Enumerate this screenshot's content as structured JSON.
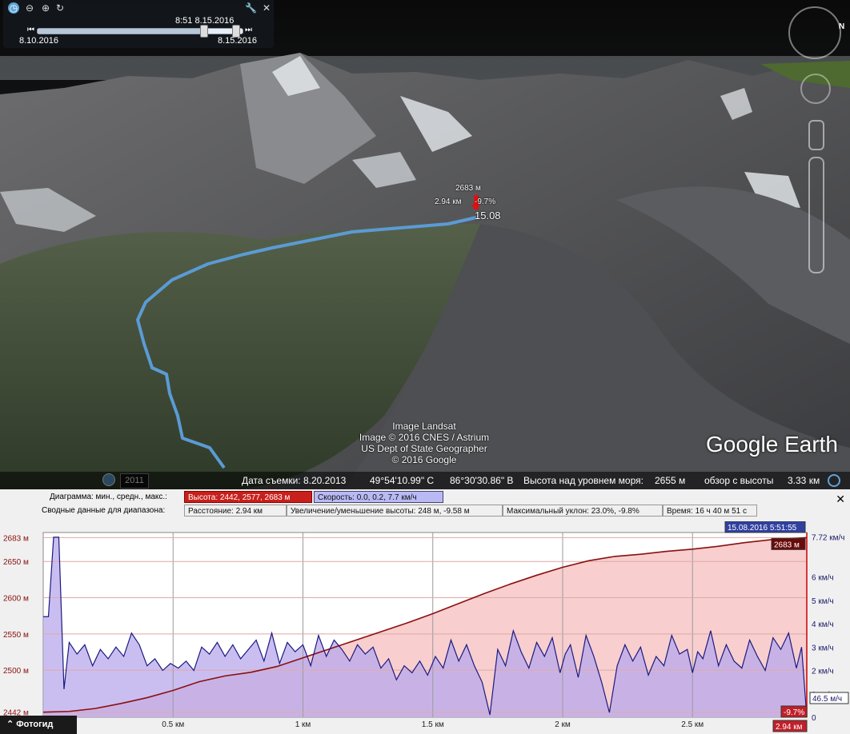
{
  "time_slider": {
    "current": "8:51 8.15.2016",
    "start": "8.10.2016",
    "end": "8.15.2016"
  },
  "map": {
    "marker_elev": "2683 м",
    "marker_dist": "2.94 км",
    "marker_grade": "-9.7%",
    "marker_time": "15.08",
    "attribution": [
      "Image Landsat",
      "Image © 2016 CNES / Astrium",
      "US Dept of State Geographer",
      "© 2016 Google"
    ],
    "brand": "Google Earth",
    "historical_year": "2011",
    "compass_letter": "N"
  },
  "status": {
    "date_label": "Дата съемки: 8.20.2013",
    "lat": "49°54'10.99\" С",
    "lon": "86°30'30.86\" В",
    "elev_label": "Высота над уровнем моря:",
    "elev_value": "2655 м",
    "eye_label": "обзор с высоты",
    "eye_value": "3.33 км"
  },
  "profile": {
    "row1_caption": "Диаграмма: мин., средн., макс.:",
    "height_box": "Высота: 2442, 2577, 2683 м",
    "speed_box": "Скорость: 0.0, 0.2, 7.7 км/ч",
    "row2_caption": "Сводные данные для диапазона:",
    "distance_box": "Расстояние: 2.94 км",
    "gain_box": "Увеличение/уменьшение высоты: 248 м, -9.58 м",
    "slope_box": "Максимальный уклон: 23.0%, -9.8%",
    "time_box": "Время: 16 ч 40 м 51 с",
    "cursor_time": "15.08.2016 5:51:55",
    "cursor_elev": "2683 м",
    "cursor_speed": "46.5 м/ч",
    "cursor_grade": "-9.7%",
    "cursor_dist": "2.94 км",
    "close": "✕"
  },
  "chart_data": {
    "type": "area",
    "x_ticks": [
      "0.5 км",
      "1 км",
      "1.5 км",
      "2 км",
      "2.5 км"
    ],
    "x_tick_values": [
      0.5,
      1,
      1.5,
      2,
      2.5
    ],
    "xlim": [
      0,
      2.94
    ],
    "y_left_ticks": [
      "2683 м",
      "2650 м",
      "2600 м",
      "2550 м",
      "2500 м",
      "2442 м"
    ],
    "y_left_values": [
      2683,
      2650,
      2600,
      2550,
      2500,
      2442
    ],
    "ylim_left": [
      2435,
      2690
    ],
    "y_right_ticks": [
      "7.72 км/ч",
      "6 км/ч",
      "5 км/ч",
      "4 км/ч",
      "3 км/ч",
      "2 км/ч",
      "1 км/ч",
      "0"
    ],
    "y_right_values": [
      7.72,
      6,
      5,
      4,
      3,
      2,
      1,
      0
    ],
    "ylim_right": [
      0,
      7.9
    ],
    "elevation": {
      "x": [
        0,
        0.1,
        0.2,
        0.3,
        0.4,
        0.5,
        0.6,
        0.7,
        0.8,
        0.9,
        1.0,
        1.1,
        1.2,
        1.3,
        1.4,
        1.5,
        1.6,
        1.7,
        1.8,
        1.9,
        2.0,
        2.1,
        2.2,
        2.3,
        2.4,
        2.5,
        2.6,
        2.7,
        2.8,
        2.9,
        2.94
      ],
      "values": [
        2442,
        2443,
        2447,
        2454,
        2462,
        2472,
        2484,
        2492,
        2497,
        2505,
        2517,
        2529,
        2541,
        2553,
        2565,
        2578,
        2592,
        2606,
        2619,
        2631,
        2642,
        2651,
        2657,
        2660,
        2664,
        2667,
        2671,
        2676,
        2680,
        2682,
        2683
      ]
    },
    "speed": {
      "x": [
        0,
        0.02,
        0.04,
        0.05,
        0.06,
        0.08,
        0.1,
        0.13,
        0.16,
        0.19,
        0.22,
        0.25,
        0.28,
        0.31,
        0.34,
        0.37,
        0.4,
        0.43,
        0.46,
        0.49,
        0.52,
        0.55,
        0.58,
        0.61,
        0.64,
        0.67,
        0.7,
        0.73,
        0.76,
        0.79,
        0.82,
        0.85,
        0.88,
        0.91,
        0.94,
        0.97,
        1.0,
        1.03,
        1.06,
        1.09,
        1.12,
        1.15,
        1.18,
        1.21,
        1.24,
        1.27,
        1.3,
        1.33,
        1.36,
        1.39,
        1.42,
        1.45,
        1.48,
        1.51,
        1.54,
        1.57,
        1.6,
        1.63,
        1.66,
        1.69,
        1.72,
        1.75,
        1.78,
        1.81,
        1.84,
        1.87,
        1.9,
        1.93,
        1.96,
        1.99,
        2.01,
        2.03,
        2.06,
        2.09,
        2.12,
        2.15,
        2.18,
        2.21,
        2.24,
        2.27,
        2.3,
        2.33,
        2.36,
        2.39,
        2.42,
        2.45,
        2.48,
        2.5,
        2.52,
        2.54,
        2.57,
        2.6,
        2.63,
        2.66,
        2.69,
        2.72,
        2.75,
        2.78,
        2.81,
        2.84,
        2.87,
        2.9,
        2.92,
        2.94
      ],
      "values": [
        4.3,
        4.3,
        7.7,
        7.7,
        7.7,
        1.2,
        3.2,
        2.7,
        3.1,
        2.2,
        2.9,
        2.5,
        3.0,
        2.6,
        3.6,
        3.1,
        2.2,
        2.5,
        2.0,
        2.3,
        2.1,
        2.4,
        2.0,
        3.0,
        2.7,
        3.2,
        2.6,
        3.1,
        2.5,
        2.9,
        3.3,
        2.4,
        3.6,
        2.3,
        3.2,
        2.8,
        3.1,
        2.2,
        3.5,
        2.6,
        3.3,
        2.9,
        2.4,
        3.1,
        2.7,
        3.0,
        2.1,
        2.5,
        1.6,
        2.2,
        1.9,
        2.4,
        1.8,
        2.6,
        2.1,
        3.3,
        2.4,
        3.1,
        2.2,
        1.5,
        0.1,
        2.9,
        2.2,
        3.7,
        2.8,
        2.1,
        3.2,
        2.6,
        3.4,
        1.9,
        2.7,
        3.1,
        1.7,
        3.5,
        2.6,
        1.5,
        0.2,
        2.2,
        3.1,
        2.4,
        3.0,
        1.8,
        2.6,
        2.2,
        3.5,
        2.7,
        2.9,
        1.9,
        2.8,
        2.5,
        3.7,
        2.2,
        3.1,
        2.4,
        2.1,
        3.3,
        2.6,
        2.0,
        3.4,
        2.9,
        3.6,
        2.1,
        3.0,
        0.0
      ]
    }
  }
}
